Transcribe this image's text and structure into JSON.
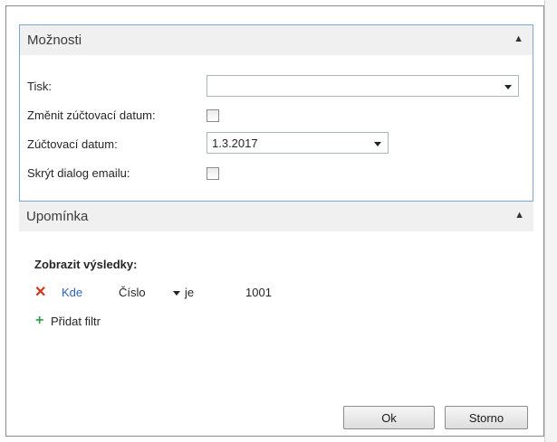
{
  "options": {
    "title": "Možnosti",
    "print_label": "Tisk:",
    "print_value": "",
    "change_date_label": "Změnit zúčtovací datum:",
    "change_date_checked": false,
    "posting_date_label": "Zúčtovací datum:",
    "posting_date_value": "1.3.2017",
    "hide_email_label": "Skrýt dialog emailu:",
    "hide_email_checked": false
  },
  "reminder": {
    "title": "Upomínka",
    "show_results_label": "Zobrazit výsledky:",
    "filter": {
      "where_label": "Kde",
      "field": "Číslo",
      "operator": "je",
      "value": "1001"
    },
    "add_filter_label": "Přidat filtr"
  },
  "buttons": {
    "ok_label": "Ok",
    "cancel_label": "Storno"
  },
  "icons": {
    "collapse": "chevron-up-icon",
    "remove_filter": "close-icon",
    "add_filter": "plus-icon"
  },
  "colors": {
    "focus_border": "#7aa6d8",
    "link": "#2a64c8",
    "remove": "#d2341c",
    "add": "#3aa04a"
  }
}
